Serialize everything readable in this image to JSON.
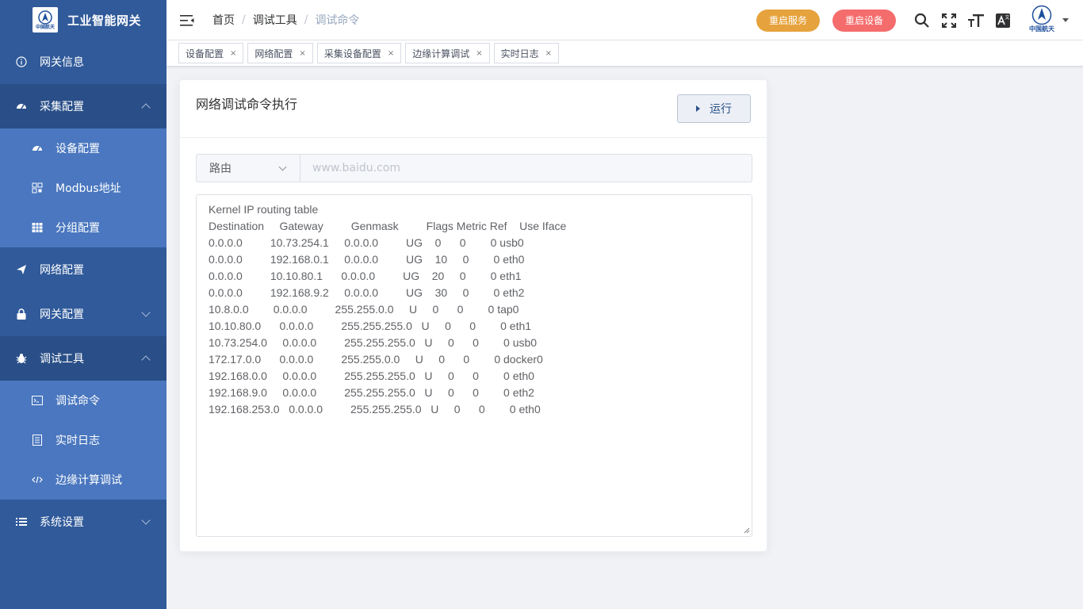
{
  "brand": {
    "title": "工业智能网关",
    "logo_text": "中国航天"
  },
  "sidebar": {
    "items": [
      {
        "label": "网关信息",
        "icon": "info-icon"
      },
      {
        "label": "采集配置",
        "icon": "dashboard-icon",
        "expanded": true,
        "children": [
          {
            "label": "设备配置",
            "icon": "dashboard-icon"
          },
          {
            "label": "Modbus地址",
            "icon": "qrcode-icon"
          },
          {
            "label": "分组配置",
            "icon": "table-icon"
          }
        ]
      },
      {
        "label": "网络配置",
        "icon": "send-icon"
      },
      {
        "label": "网关配置",
        "icon": "lock-icon",
        "expanded": false
      },
      {
        "label": "调试工具",
        "icon": "bug-icon",
        "expanded": true,
        "children": [
          {
            "label": "调试命令",
            "icon": "terminal-icon"
          },
          {
            "label": "实时日志",
            "icon": "log-icon"
          },
          {
            "label": "边缘计算调试",
            "icon": "code-icon"
          }
        ]
      },
      {
        "label": "系统设置",
        "icon": "list-icon",
        "expanded": false
      }
    ]
  },
  "breadcrumb": [
    "首页",
    "调试工具",
    "调试命令"
  ],
  "header": {
    "restart_service": "重启服务",
    "restart_device": "重启设备",
    "avatar_text": "中国航天",
    "colors": {
      "warn": "#e6a23c",
      "danger": "#f56c6c"
    }
  },
  "tags": [
    "设备配置",
    "网络配置",
    "采集设备配置",
    "边缘计算调试",
    "实时日志"
  ],
  "card": {
    "title": "网络调试命令执行",
    "run_label": "运行",
    "select_value": "路由",
    "input_placeholder": "www.baidu.com",
    "output": "Kernel IP routing table\nDestination     Gateway         Genmask         Flags Metric Ref    Use Iface\n0.0.0.0         10.73.254.1     0.0.0.0         UG    0      0        0 usb0\n0.0.0.0         192.168.0.1     0.0.0.0         UG    10     0        0 eth0\n0.0.0.0         10.10.80.1      0.0.0.0         UG    20     0        0 eth1\n0.0.0.0         192.168.9.2     0.0.0.0         UG    30     0        0 eth2\n10.8.0.0        0.0.0.0         255.255.0.0     U     0      0        0 tap0\n10.10.80.0      0.0.0.0         255.255.255.0   U     0      0        0 eth1\n10.73.254.0     0.0.0.0         255.255.255.0   U     0      0        0 usb0\n172.17.0.0      0.0.0.0         255.255.0.0     U     0      0        0 docker0\n192.168.0.0     0.0.0.0         255.255.255.0   U     0      0        0 eth0\n192.168.9.0     0.0.0.0         255.255.255.0   U     0      0        0 eth2\n192.168.253.0   0.0.0.0         255.255.255.0   U     0      0        0 eth0"
  }
}
